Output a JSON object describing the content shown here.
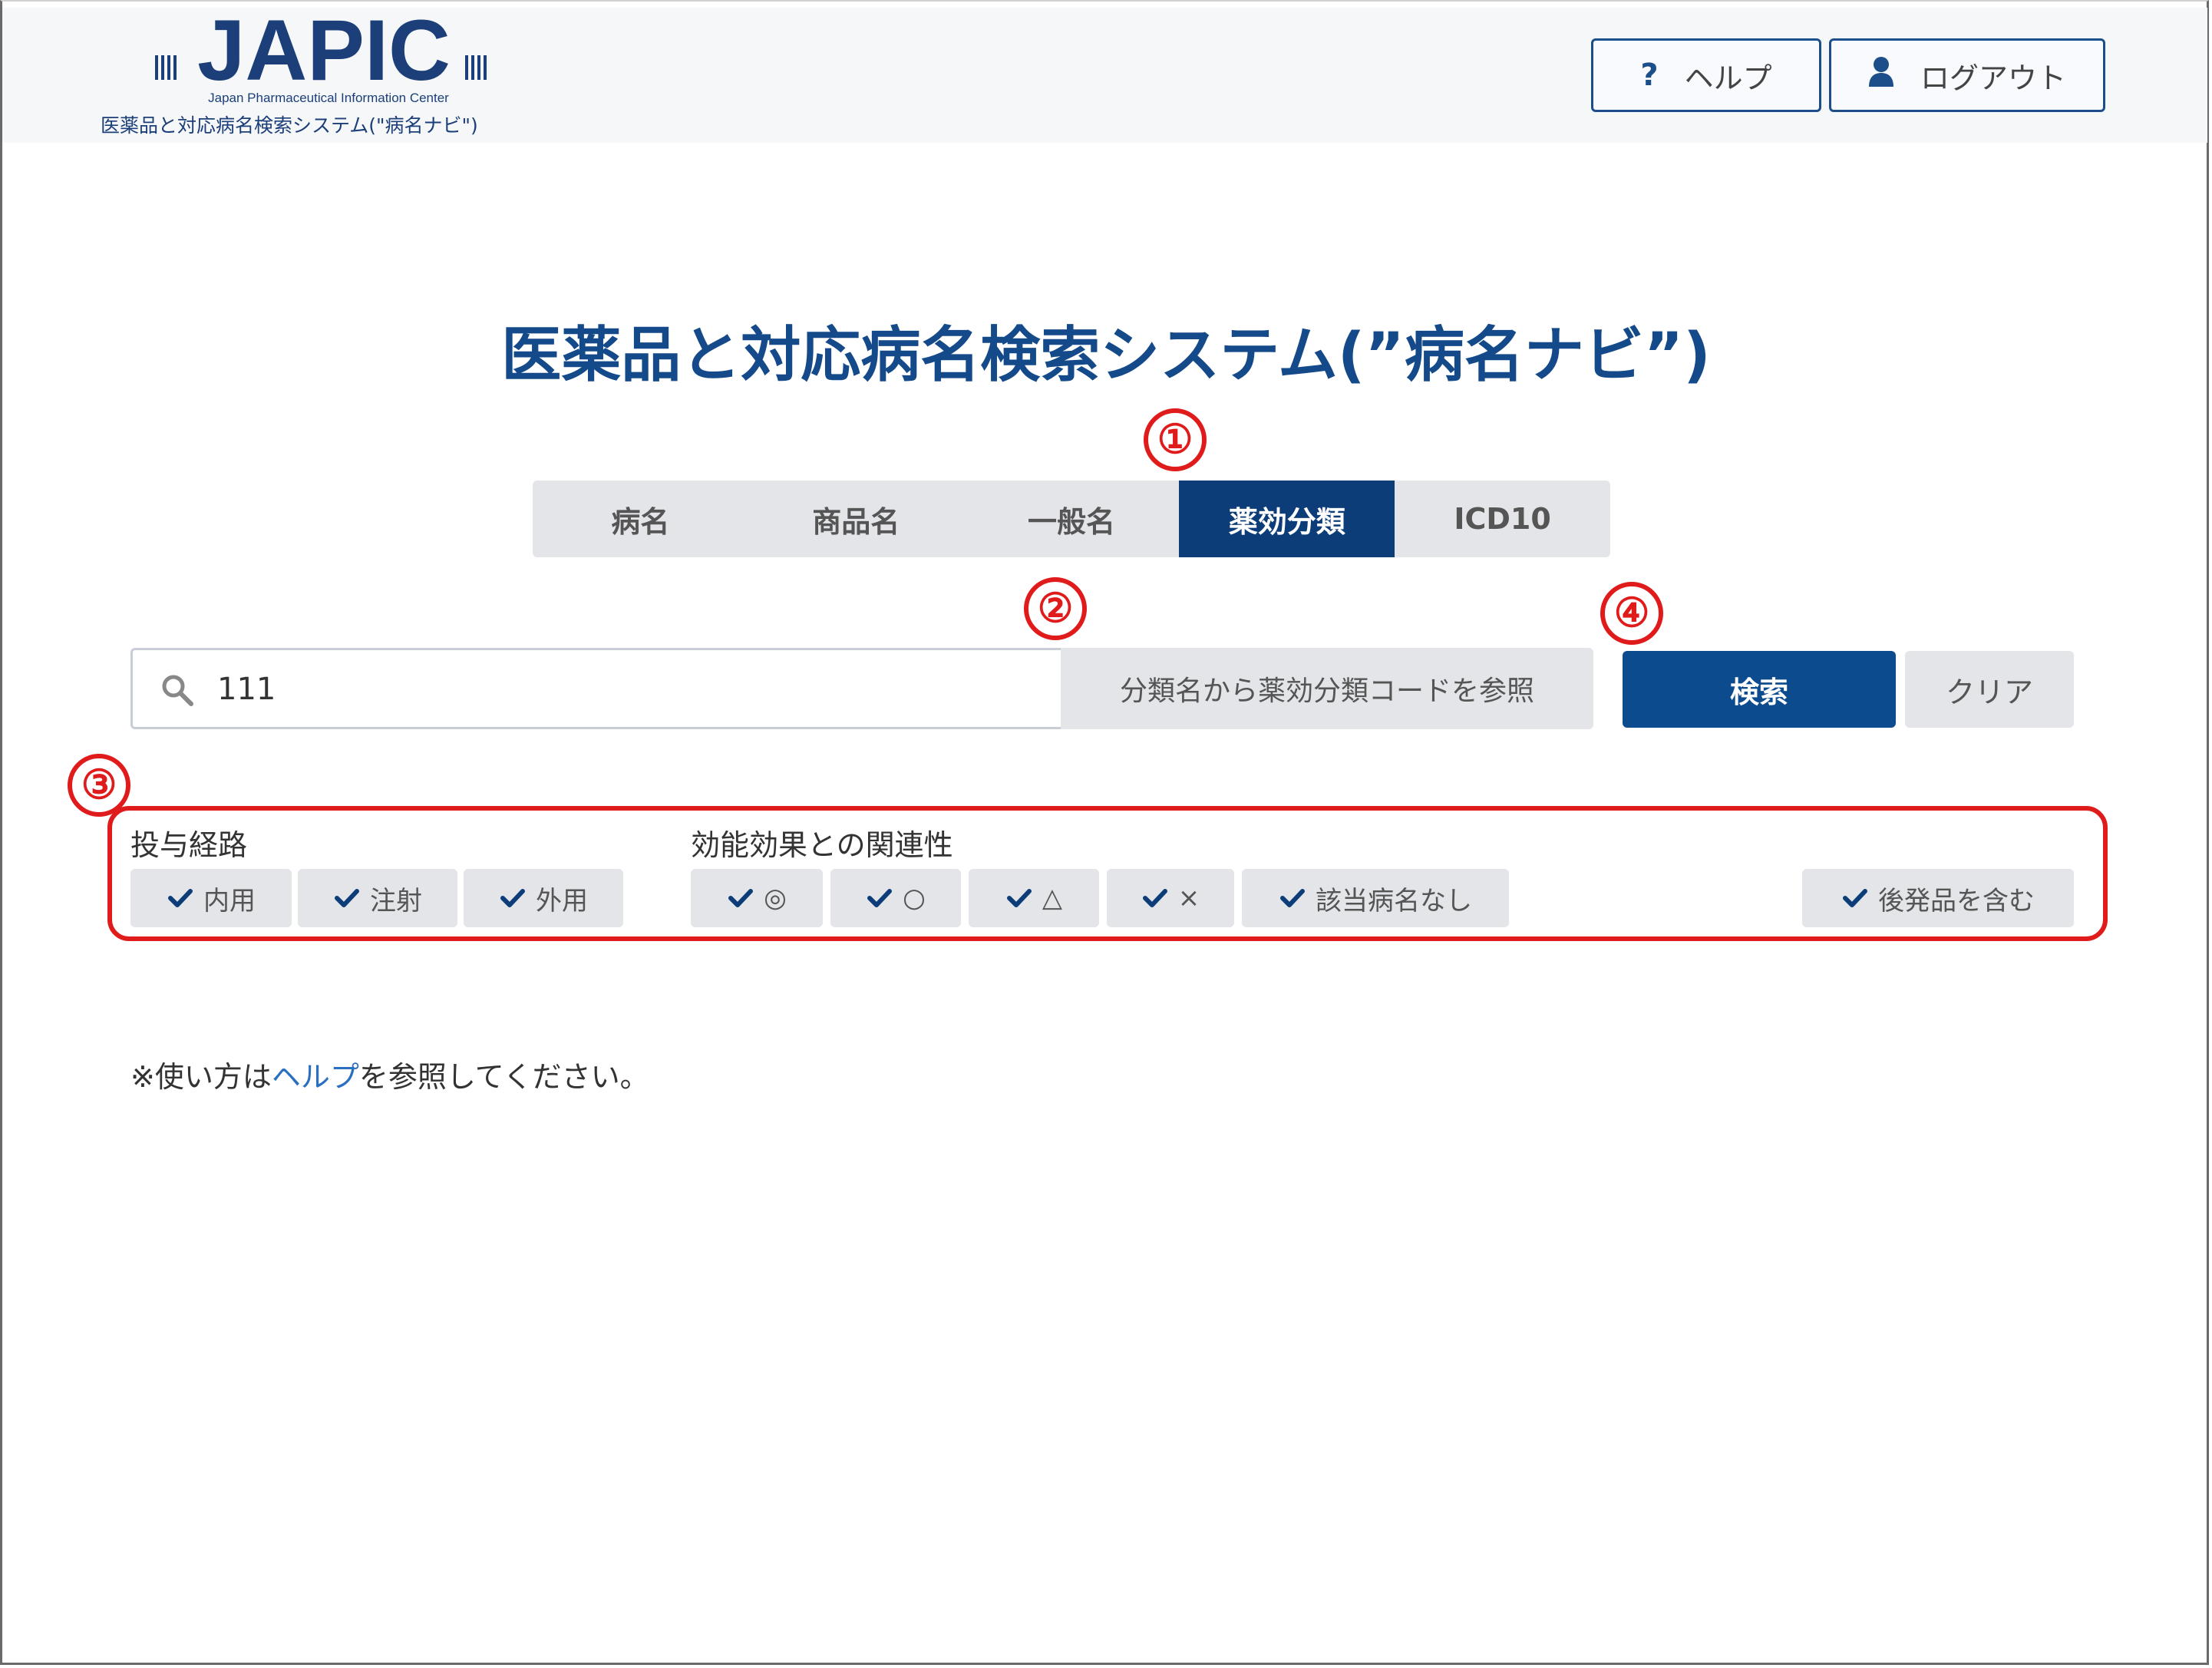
{
  "header": {
    "logo_text": "JAPIC",
    "logo_sub": "Japan Pharmaceutical Information Center",
    "logo_jp": "医薬品と対応病名検索システム(\"病名ナビ\")",
    "help_label": "ヘルプ",
    "logout_label": "ログアウト",
    "help_icon": "question-icon",
    "logout_icon": "user-icon"
  },
  "page_title": "医薬品と対応病名検索システム(”病名ナビ”)",
  "markers": [
    "①",
    "②",
    "③",
    "④"
  ],
  "tabs": [
    {
      "label": "病名",
      "active": false
    },
    {
      "label": "商品名",
      "active": false
    },
    {
      "label": "一般名",
      "active": false
    },
    {
      "label": "薬効分類",
      "active": true
    },
    {
      "label": "ICD10",
      "active": false
    }
  ],
  "search": {
    "value": "111",
    "ref_button": "分類名から薬効分類コードを参照",
    "search_button": "検索",
    "clear_button": "クリア"
  },
  "filters": {
    "route_label": "投与経路",
    "route_chips": [
      "内用",
      "注射",
      "外用"
    ],
    "relevance_label": "効能効果との関連性",
    "relevance_chips": [
      "◎",
      "○",
      "△",
      "×",
      "該当病名なし"
    ],
    "generic_chip": "後発品を含む"
  },
  "note": {
    "prefix": "※使い方は",
    "link": "ヘルプ",
    "suffix": "を参照してください。"
  },
  "colors": {
    "primary": "#0c3d78",
    "accent_red": "#e01b1b",
    "chip_bg": "#e3e5e8"
  }
}
